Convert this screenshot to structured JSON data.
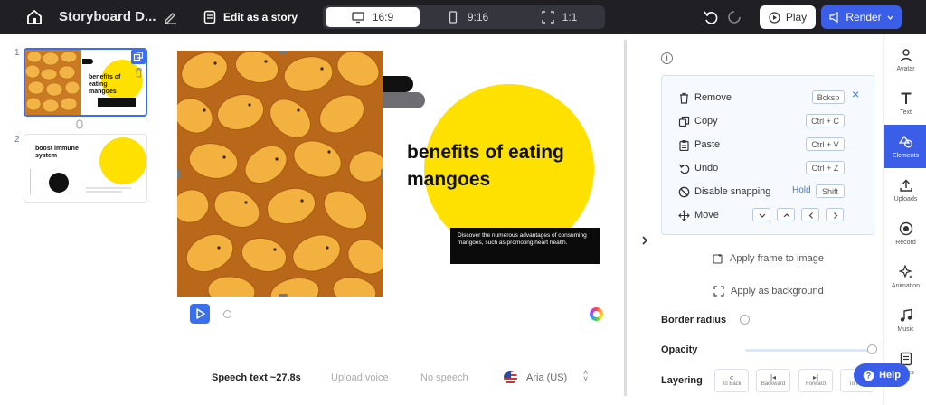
{
  "topbar": {
    "title": "Storyboard D...",
    "edit_as_story": "Edit as a story",
    "ratios": [
      "16:9",
      "9:16",
      "1:1"
    ],
    "active_ratio": "16:9",
    "play_label": "Play",
    "render_label": "Render"
  },
  "slides": [
    {
      "number": "1",
      "title": "benefits of eating mangoes"
    },
    {
      "number": "2",
      "title": "boost immune system"
    }
  ],
  "canvas": {
    "heading": "benefits of eating mangoes",
    "description": "Discover the numerous advantages of consuming mangoes, such as promoting heart health."
  },
  "speech": {
    "speech_text": "Speech text ~27.8s",
    "upload_voice": "Upload voice",
    "no_speech": "No speech",
    "voice": "Aria (US)"
  },
  "context_menu": {
    "items": [
      {
        "label": "Remove",
        "shortcut": "Bcksp"
      },
      {
        "label": "Copy",
        "shortcut": "Ctrl + C"
      },
      {
        "label": "Paste",
        "shortcut": "Ctrl + V"
      },
      {
        "label": "Undo",
        "shortcut": "Ctrl + Z"
      },
      {
        "label": "Disable snapping",
        "hold": "Hold",
        "shortcut": "Shift"
      },
      {
        "label": "Move"
      }
    ],
    "close": "×"
  },
  "panel": {
    "apply_frame": "Apply frame to image",
    "apply_background": "Apply as background",
    "border_radius": "Border radius",
    "opacity": "Opacity",
    "opacity_value": 1.0,
    "layering": "Layering",
    "layer_buttons": [
      "To Back",
      "Backward",
      "Forward",
      "To Fr..."
    ]
  },
  "rail": [
    "Avatar",
    "Text",
    "Elements",
    "Uploads",
    "Record",
    "Animation",
    "Music",
    "Notes"
  ],
  "help_label": "Help",
  "colors": {
    "accent": "#3b5ee8",
    "topbar": "#1f1f24",
    "yellow": "#ffe100"
  }
}
